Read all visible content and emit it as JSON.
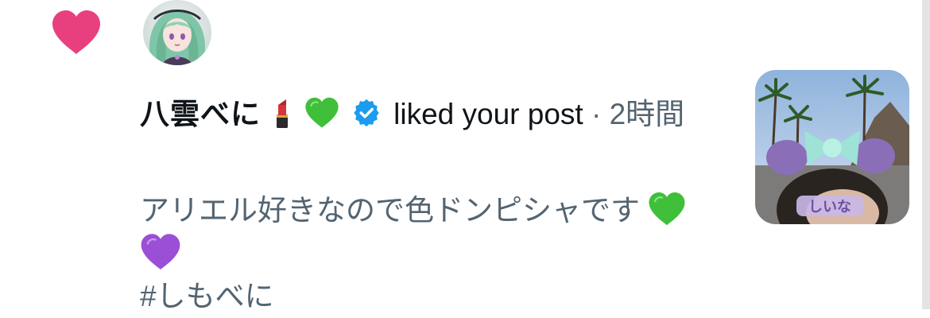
{
  "notification": {
    "icon": "heart-icon",
    "accent_color": "#E8407F",
    "username": "八雲べに",
    "username_emojis": [
      "lipstick-emoji",
      "green-heart-emoji"
    ],
    "verified": true,
    "verified_color": "#1D9BF0",
    "action": "liked your post",
    "separator": "·",
    "timestamp": "2時間",
    "post_text": "アリエル好きなので色ドンピシャです",
    "post_emojis": [
      "green-heart-emoji",
      "purple-heart-emoji"
    ],
    "hashtag": "#しもべに"
  }
}
